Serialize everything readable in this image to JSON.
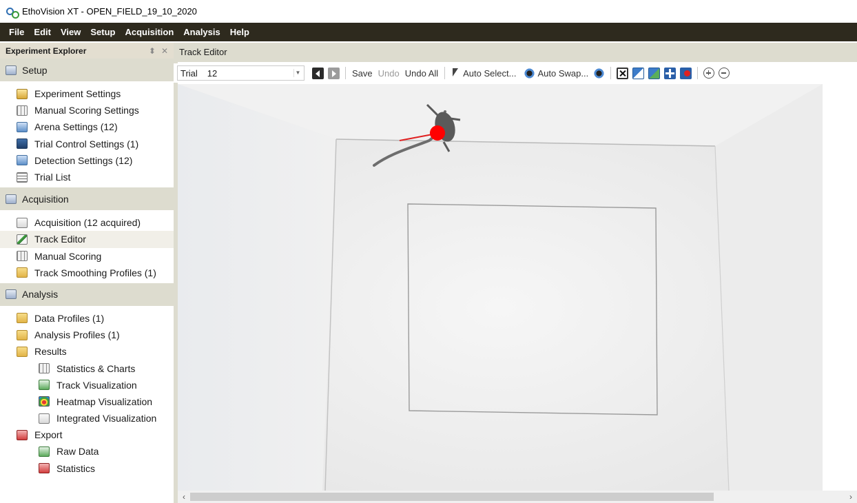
{
  "window": {
    "title": "EthoVision XT - OPEN_FIELD_19_10_2020"
  },
  "menu": [
    "File",
    "Edit",
    "View",
    "Setup",
    "Acquisition",
    "Analysis",
    "Help"
  ],
  "explorer": {
    "title": "Experiment Explorer",
    "pin_icon": "pin-icon",
    "close_icon": "close-icon",
    "groups": [
      {
        "label": "Setup",
        "icon": "setup-icon",
        "items": [
          {
            "label": "Experiment Settings",
            "icon": "experiment-settings-icon"
          },
          {
            "label": "Manual Scoring Settings",
            "icon": "manual-scoring-settings-icon"
          },
          {
            "label": "Arena Settings (12)",
            "icon": "arena-settings-icon"
          },
          {
            "label": "Trial Control Settings (1)",
            "icon": "trial-control-settings-icon"
          },
          {
            "label": "Detection Settings (12)",
            "icon": "detection-settings-icon"
          },
          {
            "label": "Trial List",
            "icon": "trial-list-icon"
          }
        ]
      },
      {
        "label": "Acquisition",
        "icon": "acquisition-icon",
        "items": [
          {
            "label": "Acquisition (12 acquired)",
            "icon": "acquisition-item-icon"
          },
          {
            "label": "Track Editor",
            "icon": "track-editor-icon",
            "selected": true
          },
          {
            "label": "Manual Scoring",
            "icon": "manual-scoring-icon"
          },
          {
            "label": "Track Smoothing Profiles (1)",
            "icon": "track-smoothing-icon"
          }
        ]
      },
      {
        "label": "Analysis",
        "icon": "analysis-icon",
        "items": [
          {
            "label": "Data Profiles (1)",
            "icon": "data-profiles-icon"
          },
          {
            "label": "Analysis Profiles (1)",
            "icon": "analysis-profiles-icon"
          },
          {
            "label": "Results",
            "icon": "results-folder-icon"
          },
          {
            "label": "Statistics & Charts",
            "icon": "statistics-charts-icon",
            "sub": true
          },
          {
            "label": "Track Visualization",
            "icon": "track-visualization-icon",
            "sub": true
          },
          {
            "label": "Heatmap Visualization",
            "icon": "heatmap-visualization-icon",
            "sub": true
          },
          {
            "label": "Integrated Visualization",
            "icon": "integrated-visualization-icon",
            "sub": true
          },
          {
            "label": "Export",
            "icon": "export-folder-icon"
          },
          {
            "label": "Raw Data",
            "icon": "raw-data-icon",
            "sub": true
          },
          {
            "label": "Statistics",
            "icon": "statistics-export-icon",
            "sub": true
          }
        ]
      }
    ]
  },
  "editor": {
    "title": "Track Editor",
    "toolbar": {
      "trial_label": "Trial",
      "trial_value": "12",
      "save": "Save",
      "undo": "Undo",
      "undo_all": "Undo All",
      "auto_select": "Auto Select...",
      "auto_swap": "Auto Swap..."
    },
    "video": {
      "subject_point_color": "#ff0000",
      "heading_line_color": "#e02020"
    }
  }
}
